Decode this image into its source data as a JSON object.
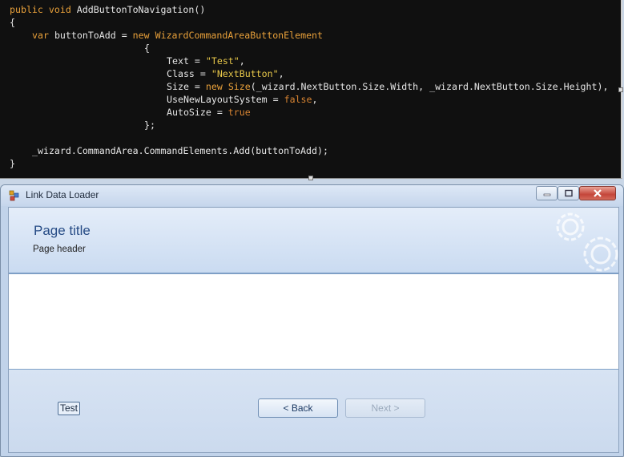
{
  "code": {
    "l1_kw1": "public",
    "l1_kw2": "void",
    "l1_name": "AddButtonToNavigation()",
    "l2": "{",
    "l3_kw": "var",
    "l3_mid": "buttonToAdd =",
    "l3_new": "new",
    "l3_class": "WizardCommandAreaButtonElement",
    "l4": "{",
    "l5_prop": "Text = ",
    "l5_val": "\"Test\"",
    "l5_end": ",",
    "l6_prop": "Class = ",
    "l6_val": "\"NextButton\"",
    "l6_end": ",",
    "l7_prop": "Size = ",
    "l7_new": "new",
    "l7_size": "Size",
    "l7_rest": "(_wizard.NextButton.Size.Width, _wizard.NextButton.Size.Height),",
    "l8_prop": "UseNewLayoutSystem = ",
    "l8_val": "false",
    "l8_end": ",",
    "l9_prop": "AutoSize = ",
    "l9_val": "true",
    "l10": "};",
    "l12": "_wizard.CommandArea.CommandElements.Add(buttonToAdd);",
    "l13": "}"
  },
  "window": {
    "title": "Link Data Loader"
  },
  "wizard": {
    "page_title": "Page title",
    "page_header": "Page header",
    "test_button": "Test",
    "back_button": "<  Back",
    "next_button": "Next  >"
  }
}
